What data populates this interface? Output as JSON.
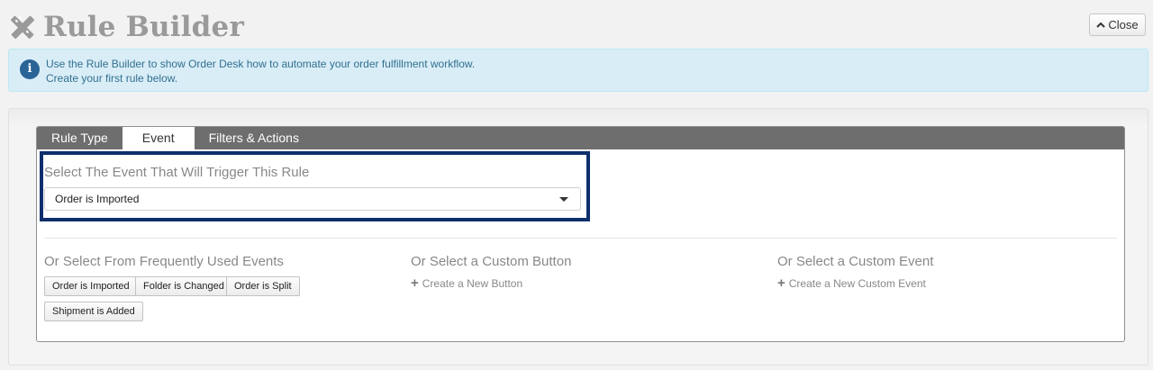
{
  "header": {
    "title": "Rule Builder",
    "close_label": "Close"
  },
  "alert": {
    "line1": "Use the Rule Builder to show Order Desk how to automate your order fulfillment workflow.",
    "line2": "Create your first rule below."
  },
  "tabs": [
    {
      "label": "Rule Type",
      "active": false
    },
    {
      "label": "Event",
      "active": true
    },
    {
      "label": "Filters & Actions",
      "active": false
    }
  ],
  "event": {
    "label": "Select The Event That Will Trigger This Rule",
    "selected": "Order is Imported"
  },
  "frequent": {
    "label": "Or Select From Frequently Used Events",
    "items": [
      "Order is Imported",
      "Folder is Changed",
      "Order is Split",
      "Shipment is Added"
    ]
  },
  "custom_button": {
    "label": "Or Select a Custom Button",
    "link": "Create a New Button"
  },
  "custom_event": {
    "label": "Or Select a Custom Event",
    "link": "Create a New Custom Event"
  },
  "colors": {
    "highlight_border": "#0e2f6b",
    "tabbar": "#6e6e6e",
    "alert_bg": "#d9edf7",
    "alert_text": "#31708f"
  },
  "icons": {
    "header": "pencil-ruler-icon",
    "alert": "info-icon",
    "close": "chevron-up-icon",
    "select": "caret-down-icon",
    "create": "plus-icon"
  }
}
